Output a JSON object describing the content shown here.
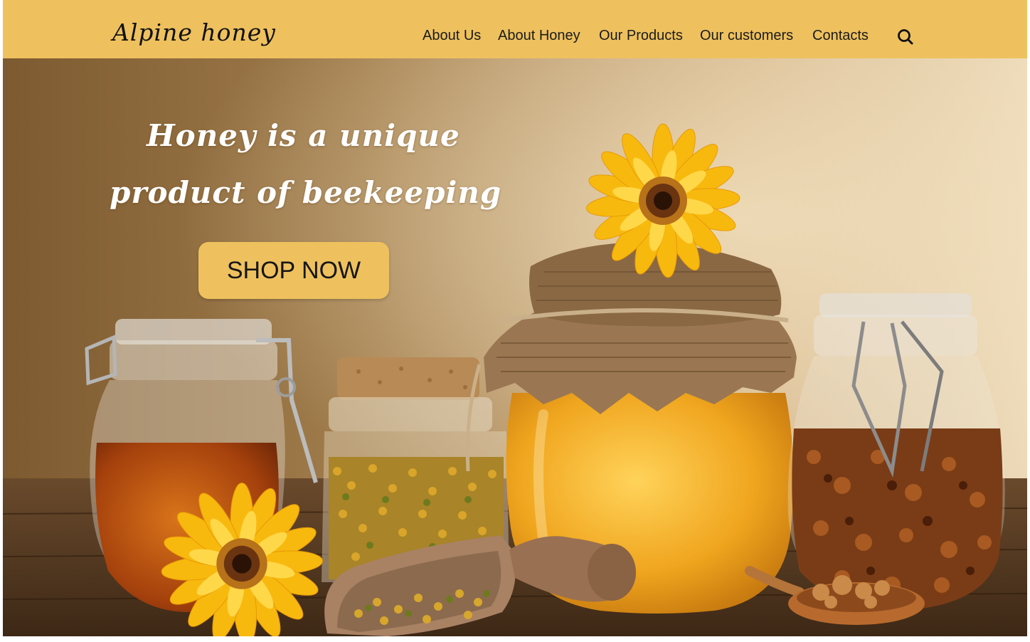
{
  "site": {
    "logo": "Alpine honey"
  },
  "nav": {
    "items": [
      "About Us",
      "About Honey",
      "Our Products",
      "Our customers",
      "Contacts"
    ],
    "search_icon": "search-icon"
  },
  "hero": {
    "headline_line1": "Honey is a unique",
    "headline_line2": "product of beekeeping",
    "cta_label": "SHOP NOW"
  },
  "colors": {
    "brand_yellow": "#eec15e",
    "hero_text": "#ffffff",
    "nav_text": "#1b1b1b"
  }
}
